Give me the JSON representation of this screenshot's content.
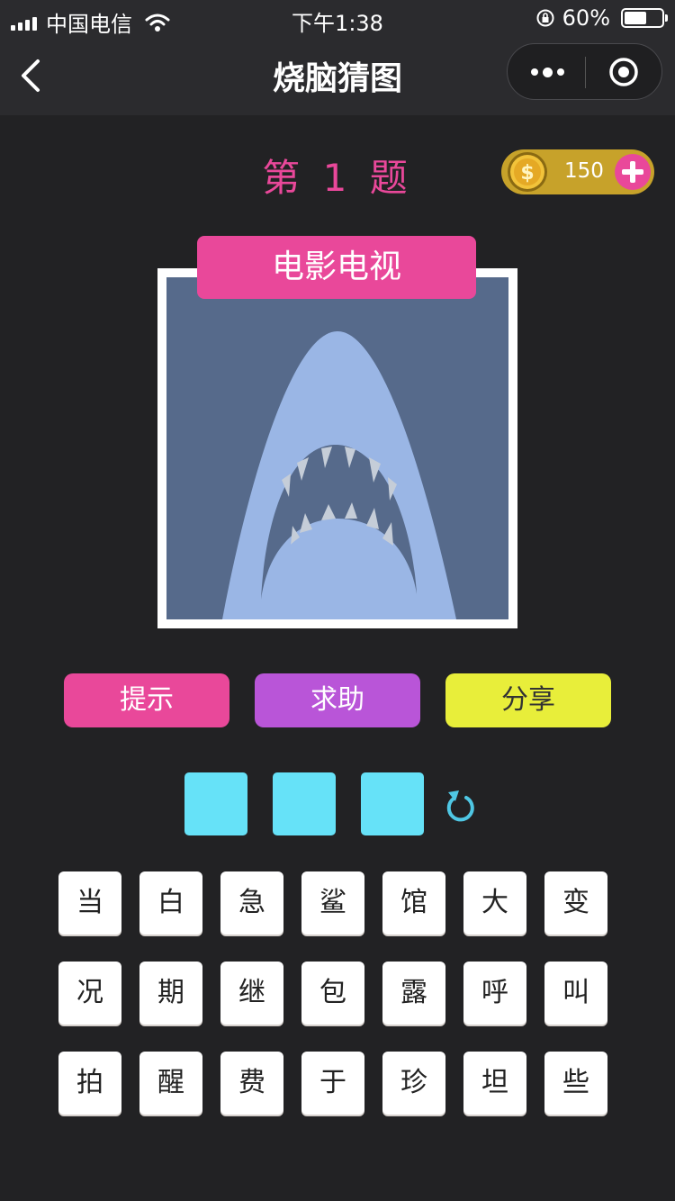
{
  "status_bar": {
    "carrier": "中国电信",
    "time": "下午1:38",
    "battery_text": "60%",
    "battery_level": 0.6
  },
  "nav": {
    "title": "烧脑猜图"
  },
  "level": {
    "prefix": "第",
    "number": "1",
    "suffix": "题"
  },
  "coins": {
    "count": "150"
  },
  "puzzle": {
    "category": "电影电视",
    "image_icon": "shark-jaws-illustration"
  },
  "actions": {
    "hint": "提示",
    "help": "求助",
    "share": "分享"
  },
  "answer": {
    "slots": [
      "",
      "",
      ""
    ]
  },
  "characters": [
    [
      "当",
      "白",
      "急",
      "鲨",
      "馆",
      "大",
      "变"
    ],
    [
      "况",
      "期",
      "继",
      "包",
      "露",
      "呼",
      "叫"
    ],
    [
      "拍",
      "醒",
      "费",
      "于",
      "珍",
      "坦",
      "些"
    ]
  ],
  "colors": {
    "accent_pink": "#e9489a",
    "help_purple": "#b955d8",
    "share_yellow": "#e8ee3a",
    "slot_cyan": "#66e2f8",
    "coin_gold": "#c7a22a",
    "background": "#222224"
  }
}
